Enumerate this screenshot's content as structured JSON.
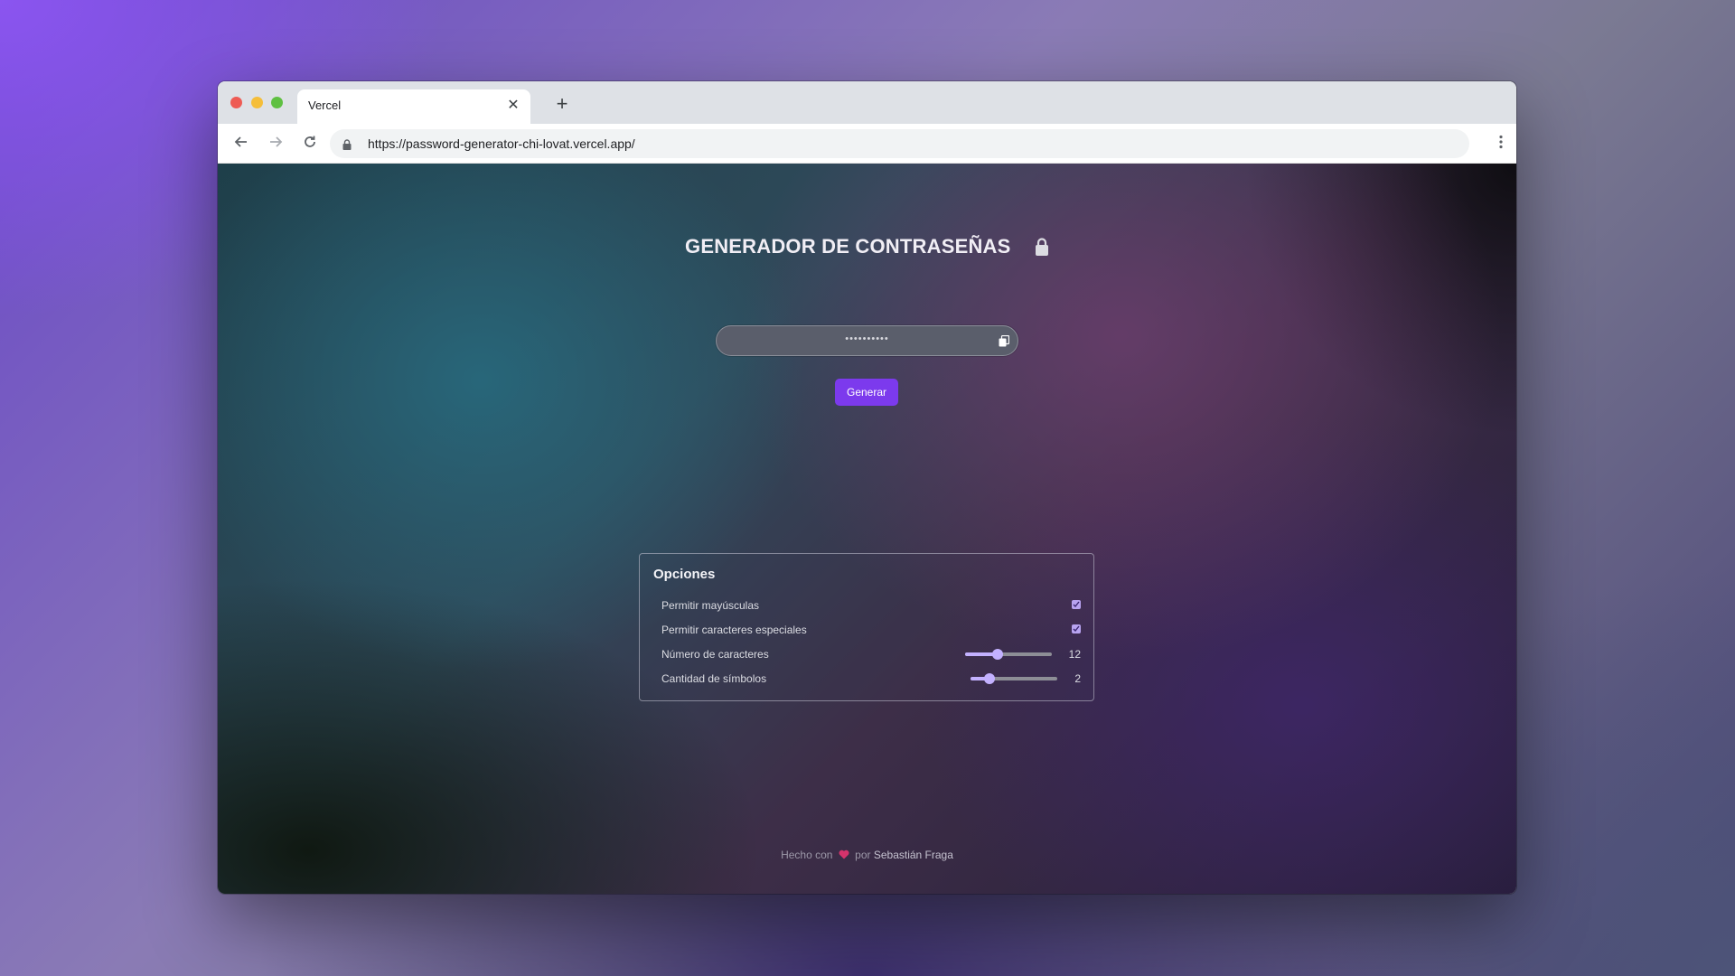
{
  "browser": {
    "tab_title": "Vercel",
    "tab_close": "✕",
    "new_tab": "+",
    "url": "https://password-generator-chi-lovat.vercel.app/"
  },
  "page": {
    "title": "GENERADOR DE CONTRASEÑAS",
    "password_value": "••••••••••",
    "generate_label": "Generar",
    "options": {
      "title": "Opciones",
      "uppercase_label": "Permitir mayúsculas",
      "uppercase_checked": true,
      "special_label": "Permitir caracteres especiales",
      "special_checked": true,
      "length_label": "Número de caracteres",
      "length_value": "12",
      "length_fraction": 0.38,
      "symbols_label": "Cantidad de símbolos",
      "symbols_value": "2",
      "symbols_fraction": 0.22
    },
    "footer": {
      "made_with": "Hecho con",
      "by": "por",
      "author": "Sebastián Fraga"
    }
  },
  "colors": {
    "accent": "#7c3aed",
    "slider": "#c3b1ff",
    "heart": "#d6336c"
  }
}
